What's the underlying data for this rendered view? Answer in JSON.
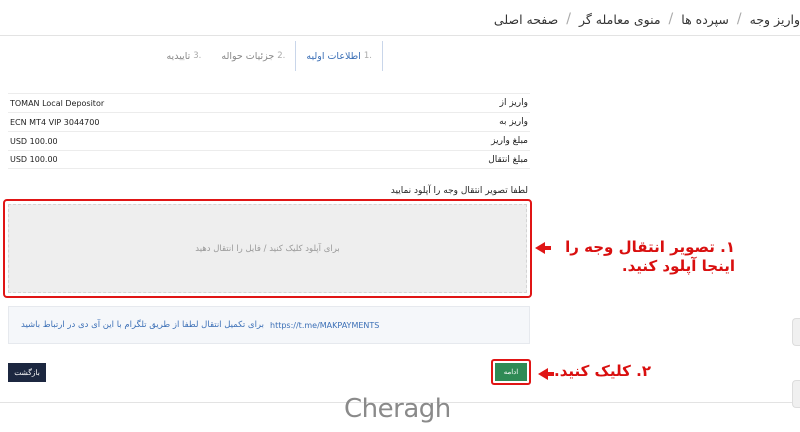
{
  "breadcrumb": {
    "items": [
      "صفحه اصلی",
      "منوی معامله گر",
      "سپرده ها",
      "واریز وجه"
    ]
  },
  "steps": [
    {
      "num": "1.",
      "label": "اطلاعات اولیه",
      "active": true
    },
    {
      "num": "2.",
      "label": "جزئیات حواله",
      "active": false
    },
    {
      "num": "3.",
      "label": "تاییدیه",
      "active": false
    }
  ],
  "details": [
    {
      "label": "واریز از",
      "value": "TOMAN Local Depositor"
    },
    {
      "label": "واریز به",
      "value": "ECN MT4 VIP 3044700"
    },
    {
      "label": "مبلغ واریز",
      "value": "USD 100.00"
    },
    {
      "label": "مبلغ انتقال",
      "value": "USD 100.00"
    }
  ],
  "upload": {
    "title": "لطفا تصویر انتقال وجه را آپلود نمایید",
    "placeholder": "برای آپلود کلیک کنید / فایل را انتقال دهید"
  },
  "annotations": {
    "step1": "۱. تصویر انتقال وجه را اینجا آپلود کنید.",
    "step2": "۲. کلیک کنید."
  },
  "telegram": {
    "text": "برای تکمیل انتقال لطفا از طریق تلگرام با این آی دی در ارتباط باشید",
    "link": "https://t.me/MAKPAYMENTS"
  },
  "buttons": {
    "back": "بازگشت",
    "continue": "ادامه"
  },
  "logo": "Cheragh",
  "colors": {
    "accent_red": "#e01515",
    "continue_green": "#2f8a55",
    "back_navy": "#1c2740",
    "link_blue": "#3b6fb6"
  }
}
